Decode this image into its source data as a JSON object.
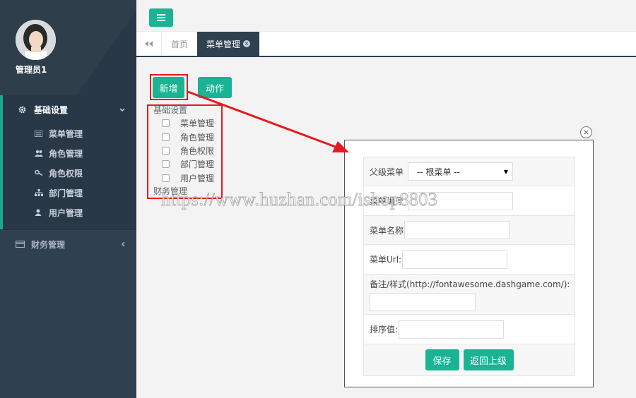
{
  "sidebar": {
    "user_name": "管理员1",
    "groups": [
      {
        "label": "基础设置",
        "icon": "gear-icon",
        "items": [
          {
            "label": "菜单管理",
            "icon": "list-icon"
          },
          {
            "label": "角色管理",
            "icon": "users-icon"
          },
          {
            "label": "角色权限",
            "icon": "key-icon"
          },
          {
            "label": "部门管理",
            "icon": "sitemap-icon"
          },
          {
            "label": "用户管理",
            "icon": "user-icon"
          }
        ]
      },
      {
        "label": "财务管理",
        "icon": "credit-card-icon"
      }
    ]
  },
  "tabs": {
    "home": "首页",
    "active": "菜单管理"
  },
  "toolbar": {
    "add_label": "新增",
    "action_label": "动作"
  },
  "tree": {
    "groups": [
      {
        "label": "基础设置",
        "items": [
          "菜单管理",
          "角色管理",
          "角色权限",
          "部门管理",
          "用户管理"
        ]
      },
      {
        "label": "财务管理",
        "items": []
      }
    ]
  },
  "watermark": "https://www.huzhan.com/ishop8803",
  "dialog": {
    "fields": {
      "parent_label": "父级菜单",
      "parent_value": "-- 根菜单 --",
      "code_label": "菜单编号",
      "name_label": "菜单名称",
      "url_label": "菜单Url:",
      "remark_label": "备注/样式(http://fontawesome.dashgame.com/):",
      "sort_label": "排序值:"
    },
    "save_label": "保存",
    "back_label": "返回上级"
  },
  "colors": {
    "accent": "#1ab394",
    "sidebar_bg": "#2f4050",
    "highlight": "#e8191d"
  }
}
